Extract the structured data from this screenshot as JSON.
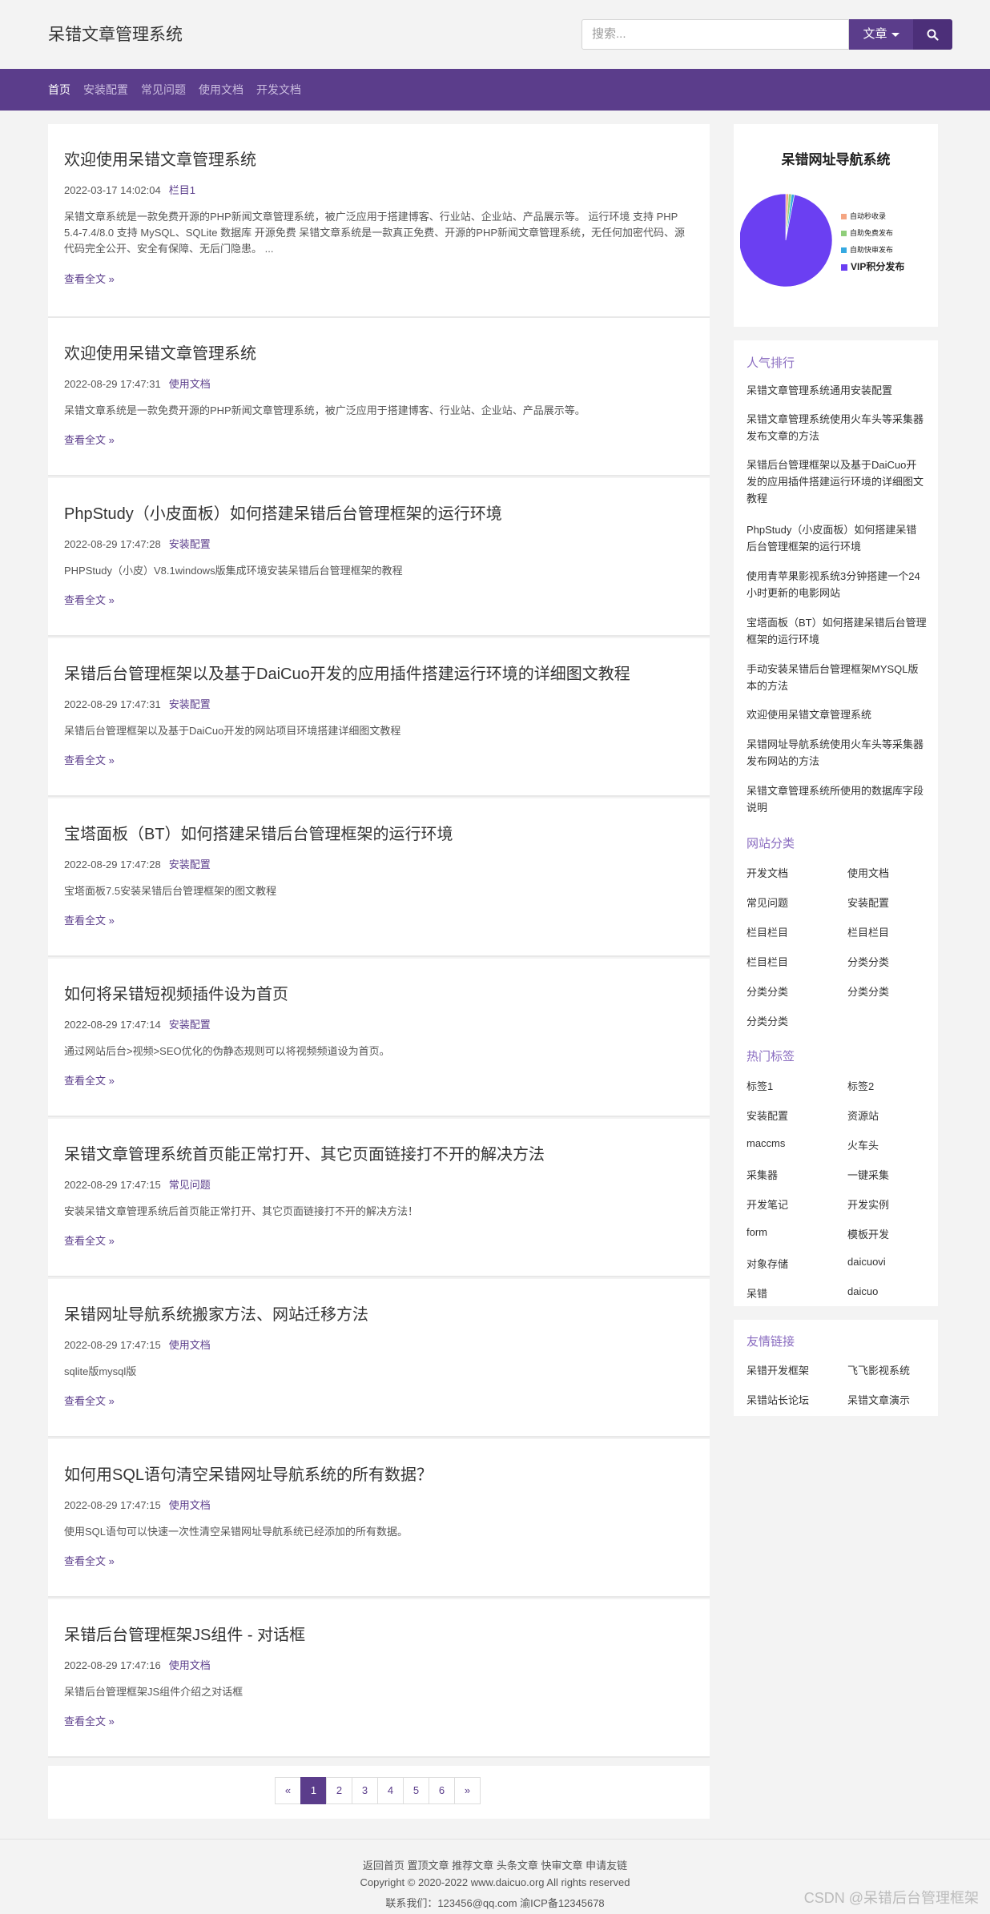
{
  "site": {
    "title": "呆错文章管理系统"
  },
  "search": {
    "placeholder": "搜索...",
    "dropdown_label": "文章"
  },
  "nav": [
    "首页",
    "安装配置",
    "常见问题",
    "使用文档",
    "开发文档"
  ],
  "read_more_label": "查看全文 »",
  "posts": [
    {
      "title": "欢迎使用呆错文章管理系统",
      "date": "2022-03-17 14:02:04",
      "category": "栏目1",
      "excerpt": "呆错文章系统是一款免费开源的PHP新闻文章管理系统，被广泛应用于搭建博客、行业站、企业站、产品展示等。 运行环境 支持 PHP 5.4-7.4/8.0 支持 MySQL、SQLite 数据库 开源免费 呆错文章系统是一款真正免费、开源的PHP新闻文章管理系统，无任何加密代码、源代码完全公开、安全有保障、无后门隐患。 ..."
    },
    {
      "title": "欢迎使用呆错文章管理系统",
      "date": "2022-08-29 17:47:31",
      "category": "使用文档",
      "excerpt": "呆错文章系统是一款免费开源的PHP新闻文章管理系统，被广泛应用于搭建博客、行业站、企业站、产品展示等。"
    },
    {
      "title": "PhpStudy（小皮面板）如何搭建呆错后台管理框架的运行环境",
      "date": "2022-08-29 17:47:28",
      "category": "安装配置",
      "excerpt": "PHPStudy（小皮）V8.1windows版集成环境安装呆错后台管理框架的教程"
    },
    {
      "title": "呆错后台管理框架以及基于DaiCuo开发的应用插件搭建运行环境的详细图文教程",
      "date": "2022-08-29 17:47:31",
      "category": "安装配置",
      "excerpt": "呆错后台管理框架以及基于DaiCuo开发的网站项目环境搭建详细图文教程"
    },
    {
      "title": "宝塔面板（BT）如何搭建呆错后台管理框架的运行环境",
      "date": "2022-08-29 17:47:28",
      "category": "安装配置",
      "excerpt": "宝塔面板7.5安装呆错后台管理框架的图文教程"
    },
    {
      "title": "如何将呆错短视频插件设为首页",
      "date": "2022-08-29 17:47:14",
      "category": "安装配置",
      "excerpt": "通过网站后台>视频>SEO优化的伪静态规则可以将视频频道设为首页。"
    },
    {
      "title": "呆错文章管理系统首页能正常打开、其它页面链接打不开的解决方法",
      "date": "2022-08-29 17:47:15",
      "category": "常见问题",
      "excerpt": "安装呆错文章管理系统后首页能正常打开、其它页面链接打不开的解决方法！"
    },
    {
      "title": "呆错网址导航系统搬家方法、网站迁移方法",
      "date": "2022-08-29 17:47:15",
      "category": "使用文档",
      "excerpt": "sqlite版mysql版"
    },
    {
      "title": "如何用SQL语句清空呆错网址导航系统的所有数据？",
      "date": "2022-08-29 17:47:15",
      "category": "使用文档",
      "excerpt": "使用SQL语句可以快速一次性清空呆错网址导航系统已经添加的所有数据。"
    },
    {
      "title": "呆错后台管理框架JS组件 - 对话框",
      "date": "2022-08-29 17:47:16",
      "category": "使用文档",
      "excerpt": "呆错后台管理框架JS组件介绍之对话框"
    }
  ],
  "pagination": [
    "«",
    "1",
    "2",
    "3",
    "4",
    "5",
    "6",
    "»"
  ],
  "sidebar": {
    "chart_widget_title": "呆错网址导航系统",
    "popular_title": "人气排行",
    "popular": [
      "呆错文章管理系统通用安装配置",
      "呆错文章管理系统使用火车头等采集器发布文章的方法",
      "呆错后台管理框架以及基于DaiCuo开发的应用插件搭建运行环境的详细图文教程",
      "PhpStudy（小皮面板）如何搭建呆错后台管理框架的运行环境",
      "使用青苹果影视系统3分钟搭建一个24小时更新的电影网站",
      "宝塔面板（BT）如何搭建呆错后台管理框架的运行环境",
      "手动安装呆错后台管理框架MYSQL版本的方法",
      "欢迎使用呆错文章管理系统",
      "呆错网址导航系统使用火车头等采集器发布网站的方法",
      "呆错文章管理系统所使用的数据库字段说明"
    ],
    "categories_title": "网站分类",
    "categories": [
      "开发文档",
      "使用文档",
      "常见问题",
      "安装配置",
      "栏目栏目",
      "栏目栏目",
      "栏目栏目",
      "分类分类",
      "分类分类",
      "分类分类",
      "分类分类"
    ],
    "tags_title": "热门标签",
    "tags": [
      "标签1",
      "标签2",
      "安装配置",
      "资源站",
      "maccms",
      "火车头",
      "采集器",
      "一键采集",
      "开发笔记",
      "开发实例",
      "form",
      "模板开发",
      "对象存储",
      "daicuovi",
      "呆错",
      "daicuo"
    ],
    "friends_title": "友情链接",
    "friends": [
      "呆错开发框架",
      "飞飞影视系统",
      "呆错站长论坛",
      "呆错文章演示"
    ]
  },
  "chart_data": {
    "type": "pie",
    "title": "呆错网址导航系统",
    "categories": [
      "自动秒收录",
      "自助免费发布",
      "自助快审发布",
      "VIP积分发布"
    ],
    "values": [
      1,
      1,
      1,
      97
    ],
    "colors": [
      "#f4a582",
      "#8fce7a",
      "#36a9e1",
      "#6b3ff2"
    ],
    "legend": "right"
  },
  "footer": {
    "links": [
      "返回首页",
      "置顶文章",
      "推荐文章",
      "头条文章",
      "快审文章",
      "申请友链"
    ],
    "copyright": "Copyright © 2020-2022 www.daicuo.org All rights reserved",
    "contact": "联系我们：123456@qq.com 渝ICP备12345678"
  },
  "watermark": "CSDN @呆错后台管理框架"
}
